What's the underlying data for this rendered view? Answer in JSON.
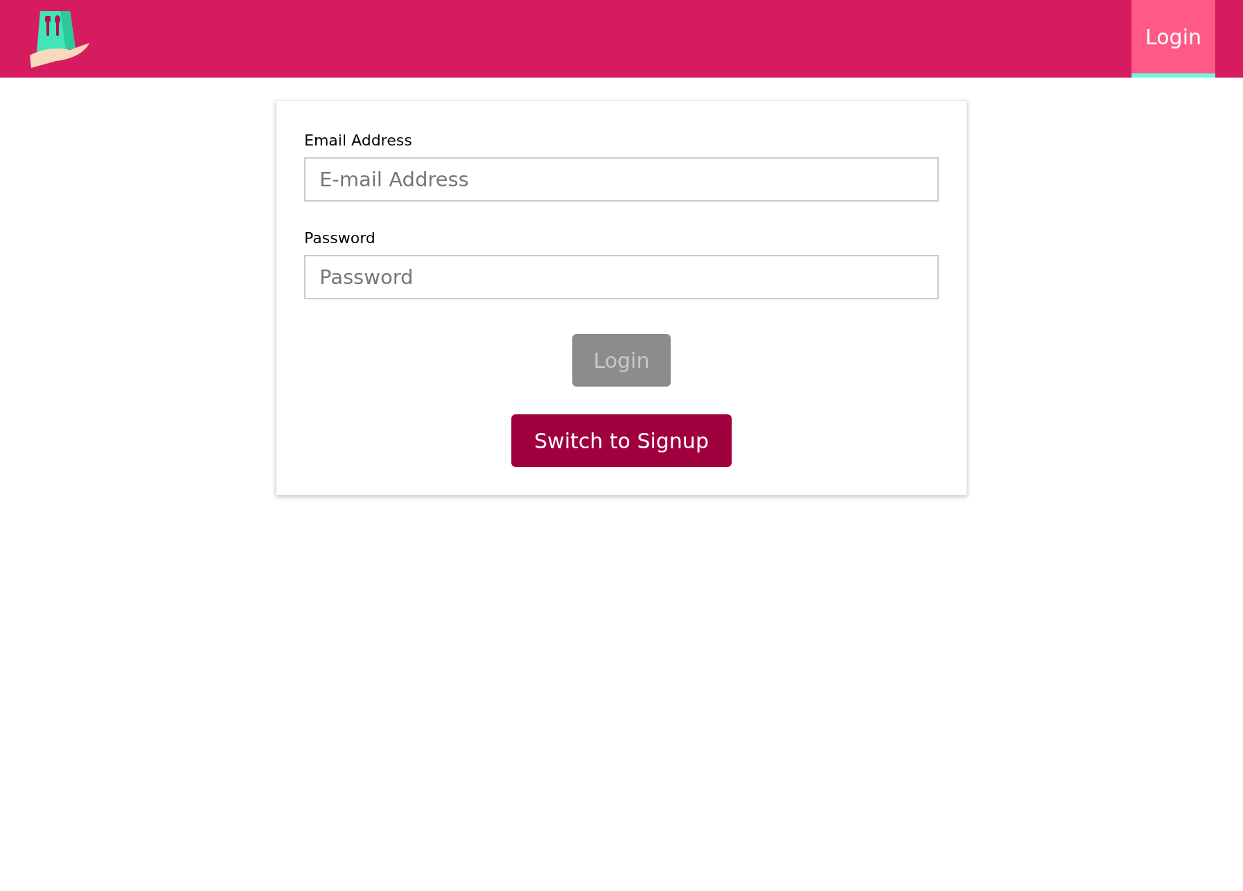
{
  "nav_links": [
    {
      "label": "Login",
      "selected": true
    }
  ],
  "form": {
    "fields": [
      {
        "label": "Email Address",
        "placeholder": "E-mail Address"
      },
      {
        "label": "Password",
        "placeholder": "Password"
      }
    ],
    "submit": {
      "label": "Login",
      "disabled": true
    },
    "switch_button": {
      "label": "Switch to Signup"
    }
  }
}
